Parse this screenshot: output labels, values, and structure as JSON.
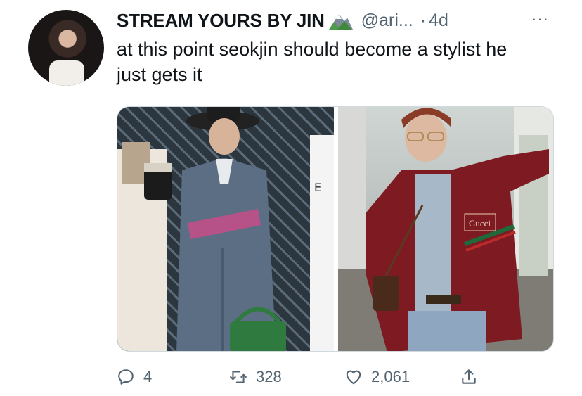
{
  "author": {
    "display_name": "STREAM YOURS BY JIN",
    "handle": "@ari...",
    "separator": "·",
    "time": "4d"
  },
  "more_label": "···",
  "tweet": {
    "text": "at this point seokjin should become a stylist he just gets it"
  },
  "media": {
    "left_photo": "fashion-photo-man-in-blue-suit-and-hat",
    "right_photo": "fashion-photo-man-in-red-gucci-jacket",
    "jacket_tag": "Gucci"
  },
  "actions": {
    "reply_count": "4",
    "retweet_count": "328",
    "like_count": "2,061"
  },
  "icons": [
    "reply-icon",
    "retweet-icon",
    "like-icon",
    "share-icon",
    "mountain-emoji-icon"
  ]
}
